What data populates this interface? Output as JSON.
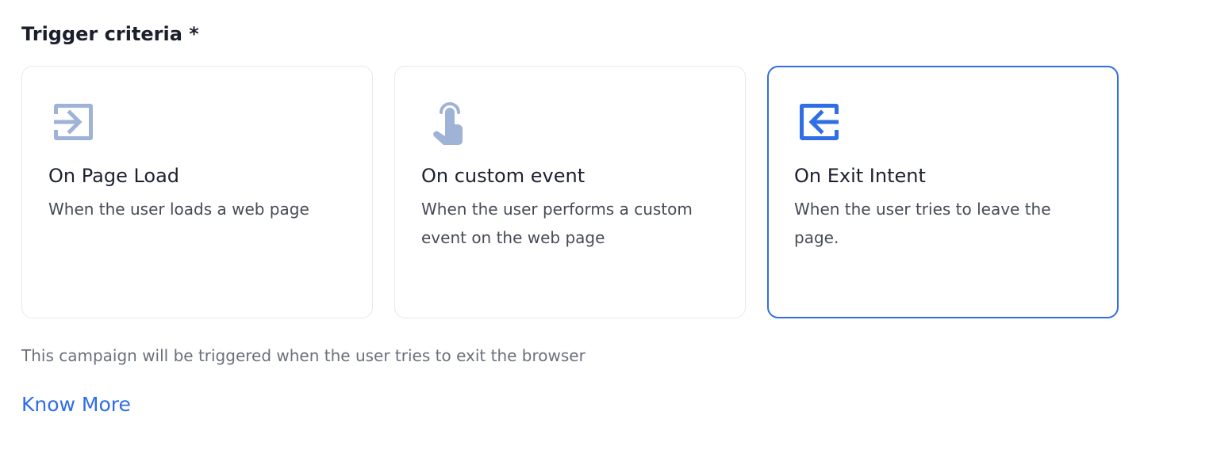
{
  "section": {
    "title": "Trigger criteria *"
  },
  "cards": [
    {
      "icon": "enter-arrow-icon",
      "title": "On Page Load",
      "description": "When the user loads a web page",
      "selected": false
    },
    {
      "icon": "tap-finger-icon",
      "title": "On custom event",
      "description": "When the user performs a custom event on the web page",
      "selected": false
    },
    {
      "icon": "exit-arrow-icon",
      "title": "On Exit Intent",
      "description": "When the user tries to leave the page.",
      "selected": true
    }
  ],
  "hint": "This campaign will be triggered when the user tries to exit the browser",
  "link": {
    "label": "Know More"
  },
  "colors": {
    "accent": "#2f6ee5",
    "icon_inactive": "#9fb3d6",
    "card_border": "#e6e8ee"
  }
}
